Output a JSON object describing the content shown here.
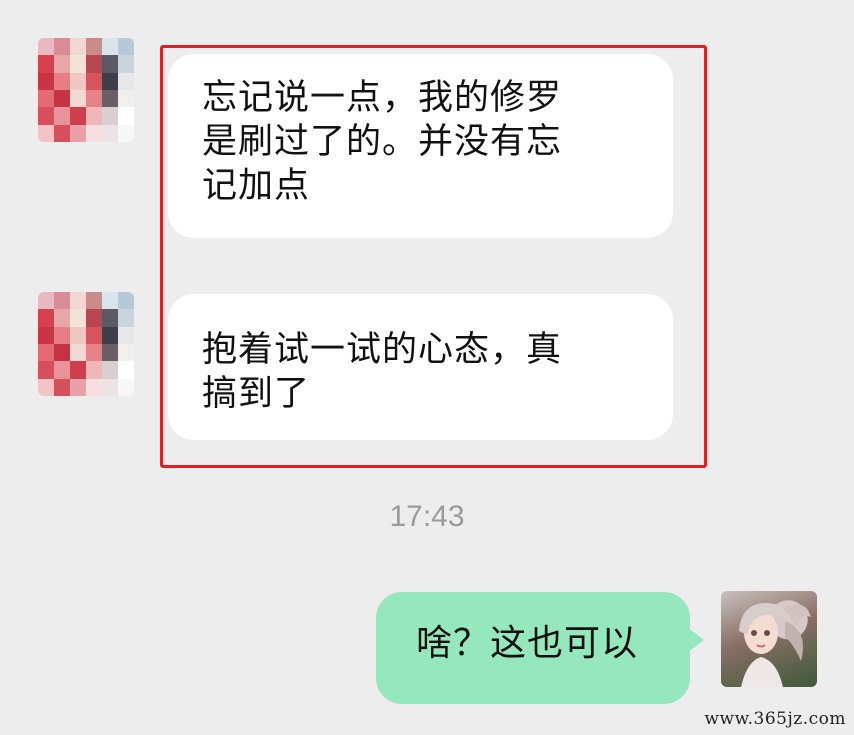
{
  "messages": [
    {
      "sender": "other",
      "avatar": "pixelated-avatar",
      "lines": [
        "忘记说一点，我的修罗",
        "是刷过了的。并没有忘",
        "记加点"
      ]
    },
    {
      "sender": "other",
      "avatar": "pixelated-avatar",
      "lines": [
        "抱着试一试的心态，真",
        "搞到了"
      ]
    }
  ],
  "timestamp": "17:43",
  "reply": {
    "sender": "me",
    "text": "啥？这也可以",
    "avatar": "anime-character-avatar"
  },
  "colors": {
    "background": "#ededed",
    "incoming_bubble": "#ffffff",
    "outgoing_bubble": "#95e8be",
    "highlight_border": "#e02020",
    "timestamp": "#9a9a9a"
  },
  "watermark": "www.365jz.com"
}
